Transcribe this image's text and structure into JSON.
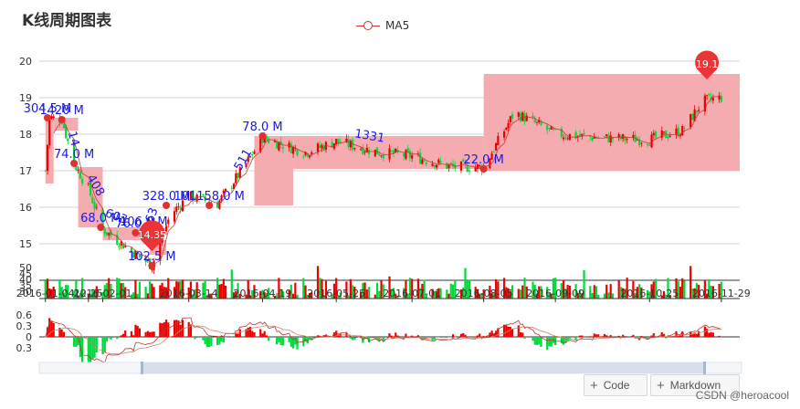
{
  "title": "K线周期图表",
  "legend_label": "MA5",
  "buttons": {
    "code": "Code",
    "markdown": "Markdown"
  },
  "watermark": "CSDN @heroacool",
  "colors": {
    "up": "#ec0000",
    "down": "#00da3c",
    "ma": "#c23531",
    "zone": "#f4a3a8",
    "pin": "#ec3335"
  },
  "chart_data": {
    "type": "candlestick",
    "title": "K线周期图表",
    "x_ticks": [
      "2016-01-04",
      "2016-01-25",
      "2016-02-01",
      "2016-03-14",
      "2016-04-19",
      "2016-05-25",
      "2016-07-01",
      "2016-08-05",
      "2016-09-09",
      "2016-10-25",
      "2016-11-29"
    ],
    "x_tick_labels": [
      "2016-01-04",
      "12-25",
      "2016-02-01",
      "2016-03-14",
      "2016-04-19",
      "2016-05-25",
      "2016-07-01",
      "2016-08-05",
      "2016-09-09",
      "2016-10-25",
      "2016-11-29"
    ],
    "price_axis": {
      "ticks": [
        15,
        16,
        17,
        18,
        19,
        20
      ],
      "ylim": [
        14.0,
        20.0
      ]
    },
    "volume_axis": {
      "tick_labels": [
        "50",
        "45",
        "40",
        "35",
        "30"
      ]
    },
    "indicator_axis": {
      "tick_labels": [
        "0.6",
        "0.3",
        "0",
        "0.3"
      ]
    },
    "price_series_keypoints": [
      {
        "date": "2016-01-04",
        "close": 17.0
      },
      {
        "date": "2016-01-06",
        "close": 18.45
      },
      {
        "date": "2016-01-12",
        "close": 18.4
      },
      {
        "date": "2016-01-18",
        "close": 17.2
      },
      {
        "date": "2016-01-25",
        "close": 16.5
      },
      {
        "date": "2016-02-01",
        "close": 15.4
      },
      {
        "date": "2016-02-15",
        "close": 14.8
      },
      {
        "date": "2016-02-25",
        "close": 14.4
      },
      {
        "date": "2016-03-05",
        "close": 15.8
      },
      {
        "date": "2016-03-14",
        "close": 16.3
      },
      {
        "date": "2016-03-28",
        "close": 16.1
      },
      {
        "date": "2016-04-10",
        "close": 17.1
      },
      {
        "date": "2016-04-19",
        "close": 17.9
      },
      {
        "date": "2016-05-10",
        "close": 17.5
      },
      {
        "date": "2016-05-25",
        "close": 17.8
      },
      {
        "date": "2016-06-15",
        "close": 17.5
      },
      {
        "date": "2016-07-01",
        "close": 17.4
      },
      {
        "date": "2016-07-20",
        "close": 17.1
      },
      {
        "date": "2016-08-05",
        "close": 17.1
      },
      {
        "date": "2016-08-20",
        "close": 18.6
      },
      {
        "date": "2016-09-09",
        "close": 18.0
      },
      {
        "date": "2016-10-01",
        "close": 17.9
      },
      {
        "date": "2016-10-25",
        "close": 17.85
      },
      {
        "date": "2016-11-10",
        "close": 18.1
      },
      {
        "date": "2016-11-20",
        "close": 18.9
      },
      {
        "date": "2016-11-29",
        "close": 19.0
      }
    ],
    "zones": [
      {
        "from": "2016-01-04",
        "to": "2016-01-08",
        "low": 16.65,
        "high": 18.45
      },
      {
        "from": "2016-01-08",
        "to": "2016-01-20",
        "low": 18.1,
        "high": 18.45
      },
      {
        "from": "2016-01-20",
        "to": "2016-02-01",
        "low": 15.45,
        "high": 17.1
      },
      {
        "from": "2016-02-01",
        "to": "2016-02-24",
        "low": 15.1,
        "high": 15.45
      },
      {
        "from": "2016-02-24",
        "to": "2016-03-03",
        "low": 14.7,
        "high": 15.1
      },
      {
        "from": "2016-04-15",
        "to": "2016-05-04",
        "low": 16.05,
        "high": 17.95
      },
      {
        "from": "2016-05-04",
        "to": "2016-08-05",
        "low": 17.05,
        "high": 17.95
      },
      {
        "from": "2016-08-05",
        "to": "2016-12-08",
        "low": 17.0,
        "high": 19.65
      }
    ],
    "annotations": [
      {
        "text": "304.5 M",
        "date": "2016-01-05",
        "value": 18.45,
        "rotation": 0
      },
      {
        "text": "1420 M",
        "date": "2016-01-12",
        "value": 18.4,
        "rotation": 0
      },
      {
        "text": "14",
        "date": "2016-01-16",
        "value": 17.7,
        "rotation": 75
      },
      {
        "text": "74.0 M",
        "date": "2016-01-18",
        "value": 17.2,
        "rotation": 0
      },
      {
        "text": "408",
        "date": "2016-01-27",
        "value": 16.4,
        "rotation": 60
      },
      {
        "text": "68.0 M",
        "date": "2016-01-31",
        "value": 15.45,
        "rotation": 0
      },
      {
        "text": "603",
        "date": "2016-02-07",
        "value": 15.5,
        "rotation": 20
      },
      {
        "text": "76.0 M",
        "date": "2016-02-17",
        "value": 15.3,
        "rotation": 0
      },
      {
        "text": "106.0 M",
        "date": "2016-02-21",
        "value": 15.35,
        "rotation": 0
      },
      {
        "text": "163",
        "date": "2016-02-26",
        "value": 15.5,
        "rotation": -70
      },
      {
        "text": "102.5 M",
        "date": "2016-02-25",
        "value": 14.4,
        "rotation": 0
      },
      {
        "text": "328.0 M",
        "date": "2016-03-03",
        "value": 16.05,
        "rotation": 0
      },
      {
        "text": "101158.0 M",
        "date": "2016-03-24",
        "value": 16.05,
        "rotation": 0
      },
      {
        "text": "511",
        "date": "2016-04-11",
        "value": 17.1,
        "rotation": -60
      },
      {
        "text": "78.0 M",
        "date": "2016-04-19",
        "value": 17.95,
        "rotation": 0
      },
      {
        "text": "1331",
        "date": "2016-06-10",
        "value": 17.7,
        "rotation": 10
      },
      {
        "text": "22.0 M",
        "date": "2016-08-05",
        "value": 17.05,
        "rotation": 0
      }
    ],
    "pins": [
      {
        "text": "14.35",
        "date": "2016-02-25",
        "value": 14.8,
        "size": "large"
      },
      {
        "text": "19.1",
        "date": "2016-11-22",
        "value": 19.5,
        "size": "small"
      }
    ]
  }
}
